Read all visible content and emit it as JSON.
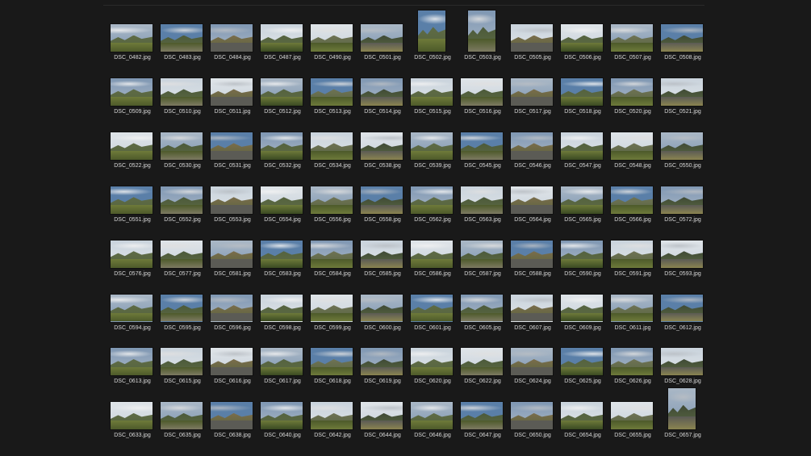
{
  "window": {
    "background": "#191919",
    "label_color": "#d8d8d8"
  },
  "files": [
    "DSC_0482.jpg",
    "DSC_0483.jpg",
    "DSC_0484.jpg",
    "DSC_0487.jpg",
    "DSC_0490.jpg",
    "DSC_0501.jpg",
    "DSC_0502.jpg",
    "DSC_0503.jpg",
    "DSC_0505.jpg",
    "DSC_0506.jpg",
    "DSC_0507.jpg",
    "DSC_0508.jpg",
    "DSC_0509.jpg",
    "DSC_0510.jpg",
    "DSC_0511.jpg",
    "DSC_0512.jpg",
    "DSC_0513.jpg",
    "DSC_0514.jpg",
    "DSC_0515.jpg",
    "DSC_0516.jpg",
    "DSC_0517.jpg",
    "DSC_0518.jpg",
    "DSC_0520.jpg",
    "DSC_0521.jpg",
    "DSC_0522.jpg",
    "DSC_0530.jpg",
    "DSC_0531.jpg",
    "DSC_0532.jpg",
    "DSC_0534.jpg",
    "DSC_0538.jpg",
    "DSC_0539.jpg",
    "DSC_0545.jpg",
    "DSC_0546.jpg",
    "DSC_0547.jpg",
    "DSC_0548.jpg",
    "DSC_0550.jpg",
    "DSC_0551.jpg",
    "DSC_0552.jpg",
    "DSC_0553.jpg",
    "DSC_0554.jpg",
    "DSC_0556.jpg",
    "DSC_0558.jpg",
    "DSC_0562.jpg",
    "DSC_0563.jpg",
    "DSC_0564.jpg",
    "DSC_0565.jpg",
    "DSC_0566.jpg",
    "DSC_0572.jpg",
    "DSC_0576.jpg",
    "DSC_0577.jpg",
    "DSC_0581.jpg",
    "DSC_0583.jpg",
    "DSC_0584.jpg",
    "DSC_0585.jpg",
    "DSC_0586.jpg",
    "DSC_0587.jpg",
    "DSC_0588.jpg",
    "DSC_0590.jpg",
    "DSC_0591.jpg",
    "DSC_0593.jpg",
    "DSC_0594.jpg",
    "DSC_0595.jpg",
    "DSC_0596.jpg",
    "DSC_0598.jpg",
    "DSC_0599.jpg",
    "DSC_0600.jpg",
    "DSC_0601.jpg",
    "DSC_0605.jpg",
    "DSC_0607.jpg",
    "DSC_0609.jpg",
    "DSC_0611.jpg",
    "DSC_0612.jpg",
    "DSC_0613.jpg",
    "DSC_0615.jpg",
    "DSC_0616.jpg",
    "DSC_0617.jpg",
    "DSC_0618.jpg",
    "DSC_0619.jpg",
    "DSC_0620.jpg",
    "DSC_0622.jpg",
    "DSC_0624.jpg",
    "DSC_0625.jpg",
    "DSC_0626.jpg",
    "DSC_0628.jpg",
    "DSC_0633.jpg",
    "DSC_0635.jpg",
    "DSC_0638.jpg",
    "DSC_0640.jpg",
    "DSC_0642.jpg",
    "DSC_0644.jpg",
    "DSC_0646.jpg",
    "DSC_0647.jpg",
    "DSC_0650.jpg",
    "DSC_0654.jpg",
    "DSC_0655.jpg",
    "DSC_0657.jpg"
  ],
  "portrait_files": [
    "DSC_0502.jpg",
    "DSC_0503.jpg",
    "DSC_0657.jpg"
  ],
  "palette": {
    "skies": [
      "#c9d3dc",
      "#aab8c6",
      "#7f97b3",
      "#dfe4e8",
      "#5a7fa8"
    ],
    "clouds": [
      "#f2f2f2",
      "#e0e0e0",
      "#b9bec4"
    ],
    "hills": [
      "#4c5a3a",
      "#5e6b45",
      "#3f4a35",
      "#6f7355",
      "#55633f",
      "#7b6d4b"
    ],
    "grounds": [
      "#3a4a22",
      "#6e7a3a",
      "#8a8450",
      "#4d5a2a",
      "#7d7a62",
      "#5b5b55"
    ]
  }
}
